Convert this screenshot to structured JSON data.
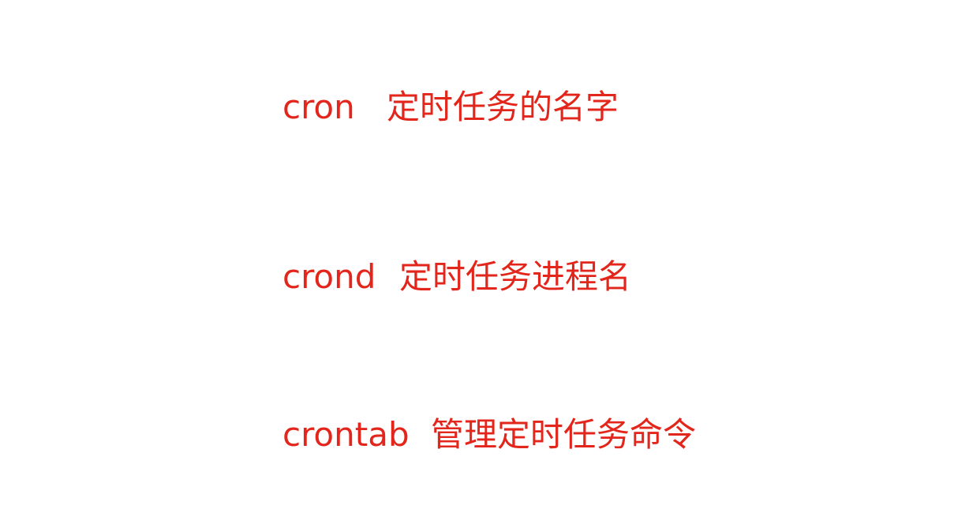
{
  "colors": {
    "text": "#e3261c",
    "background": "#ffffff"
  },
  "lines": [
    {
      "term": "cron",
      "description": "定时任务的名字"
    },
    {
      "term": "crond",
      "description": "定时任务进程名"
    },
    {
      "term": "crontab",
      "description": "管理定时任务命令"
    }
  ]
}
